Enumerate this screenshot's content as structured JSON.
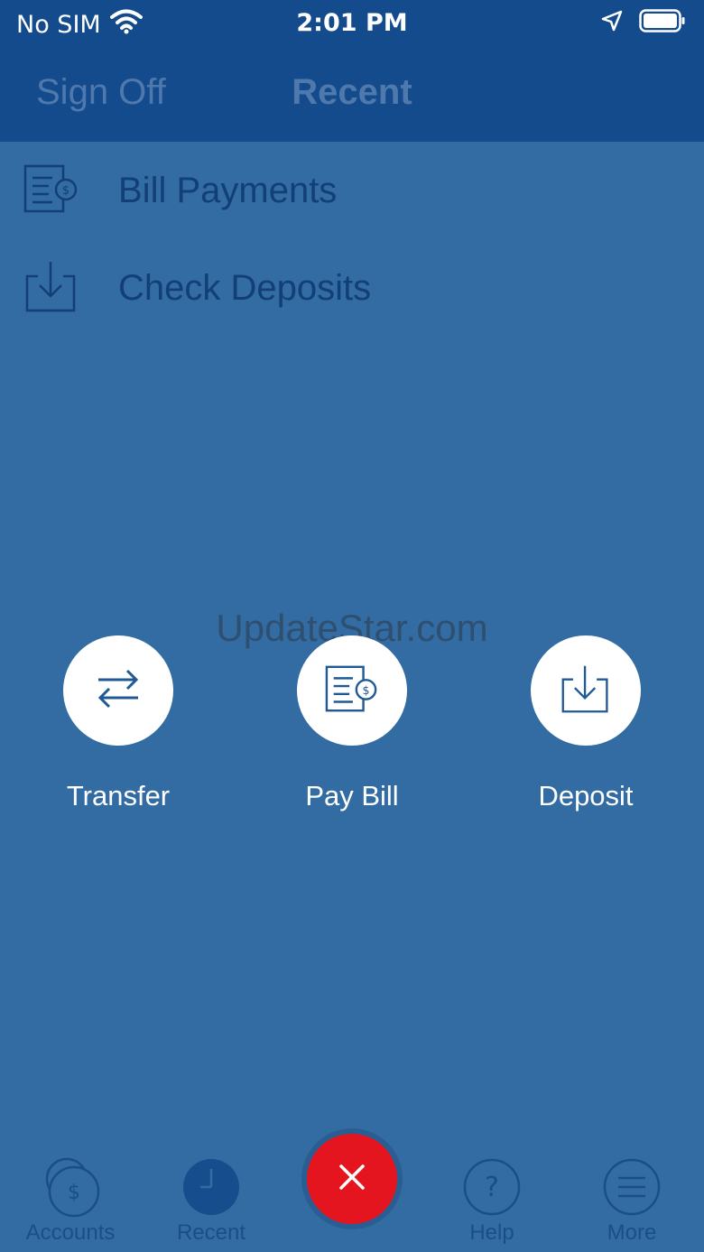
{
  "status_bar": {
    "carrier": "No SIM",
    "time": "2:01 PM"
  },
  "nav": {
    "sign_off": "Sign Off",
    "title": "Recent"
  },
  "menu": [
    {
      "label": "Bill Payments",
      "icon": "bill-icon"
    },
    {
      "label": "Check Deposits",
      "icon": "deposit-icon"
    }
  ],
  "watermark": "UpdateStar.com",
  "actions": [
    {
      "label": "Transfer",
      "icon": "transfer-arrows-icon"
    },
    {
      "label": "Pay Bill",
      "icon": "bill-icon"
    },
    {
      "label": "Deposit",
      "icon": "deposit-icon"
    }
  ],
  "tabs": [
    {
      "label": "Accounts",
      "icon": "accounts-coin-icon"
    },
    {
      "label": "Recent",
      "icon": "clock-icon"
    },
    {
      "label": "Help",
      "icon": "help-icon"
    },
    {
      "label": "More",
      "icon": "menu-icon"
    }
  ],
  "colors": {
    "overlay": "#326ca2",
    "header": "#134b8d",
    "close_button": "#e4151f"
  }
}
